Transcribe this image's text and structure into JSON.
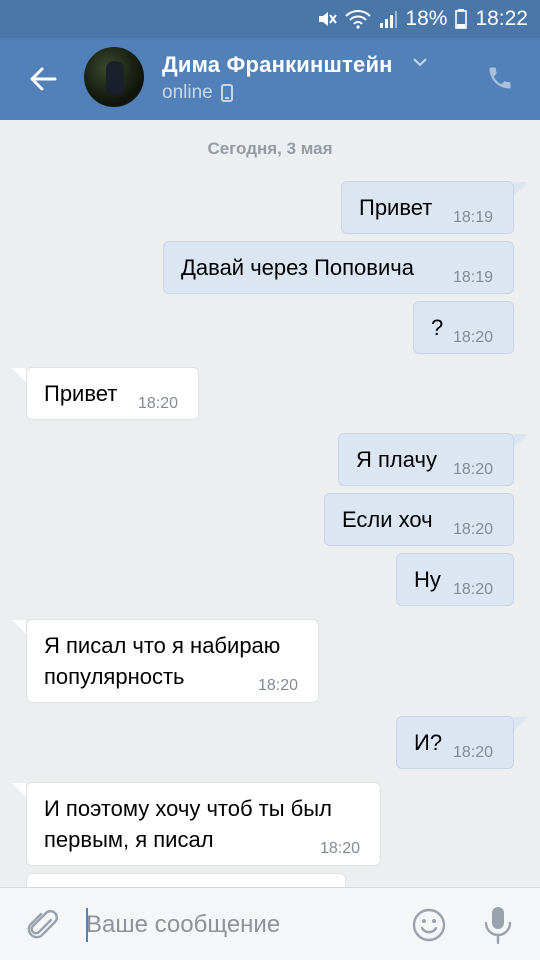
{
  "status_bar": {
    "battery": "18%",
    "time": "18:22"
  },
  "header": {
    "contact_name": "Дима Франкинштейн",
    "status": "online"
  },
  "chat": {
    "date": "Сегодня, 3 мая",
    "messages": [
      {
        "dir": "out",
        "text": "Привет",
        "time": "18:19"
      },
      {
        "dir": "out",
        "text": "Давай через Поповича",
        "time": "18:19"
      },
      {
        "dir": "out",
        "text": "?",
        "time": "18:20"
      },
      {
        "dir": "in",
        "text": "Привет",
        "time": "18:20"
      },
      {
        "dir": "out",
        "text": "Я плачу",
        "time": "18:20"
      },
      {
        "dir": "out",
        "text": "Если хоч",
        "time": "18:20"
      },
      {
        "dir": "out",
        "text": "Ну",
        "time": "18:20"
      },
      {
        "dir": "in",
        "text": "Я писал что я набираю",
        "text2": "популярность",
        "time": "18:20"
      },
      {
        "dir": "out",
        "text": "И?",
        "time": "18:20"
      },
      {
        "dir": "in",
        "text": "И поэтому хочу чтоб ты был",
        "text2": "первым, я писал",
        "time": "18:20"
      }
    ]
  },
  "composer": {
    "placeholder": "Ваше сообщение"
  },
  "icons": {
    "back": "arrow-left-icon",
    "phone": "phone-icon",
    "attach": "paperclip-icon",
    "emoji": "smile-icon",
    "mic": "microphone-icon",
    "mobile": "mobile-device-icon"
  },
  "colors": {
    "header": "#5181b8",
    "statusbar": "#4a76a8",
    "out_bubble": "#dce6f3",
    "in_bubble": "#ffffff",
    "background": "#edeef0"
  }
}
